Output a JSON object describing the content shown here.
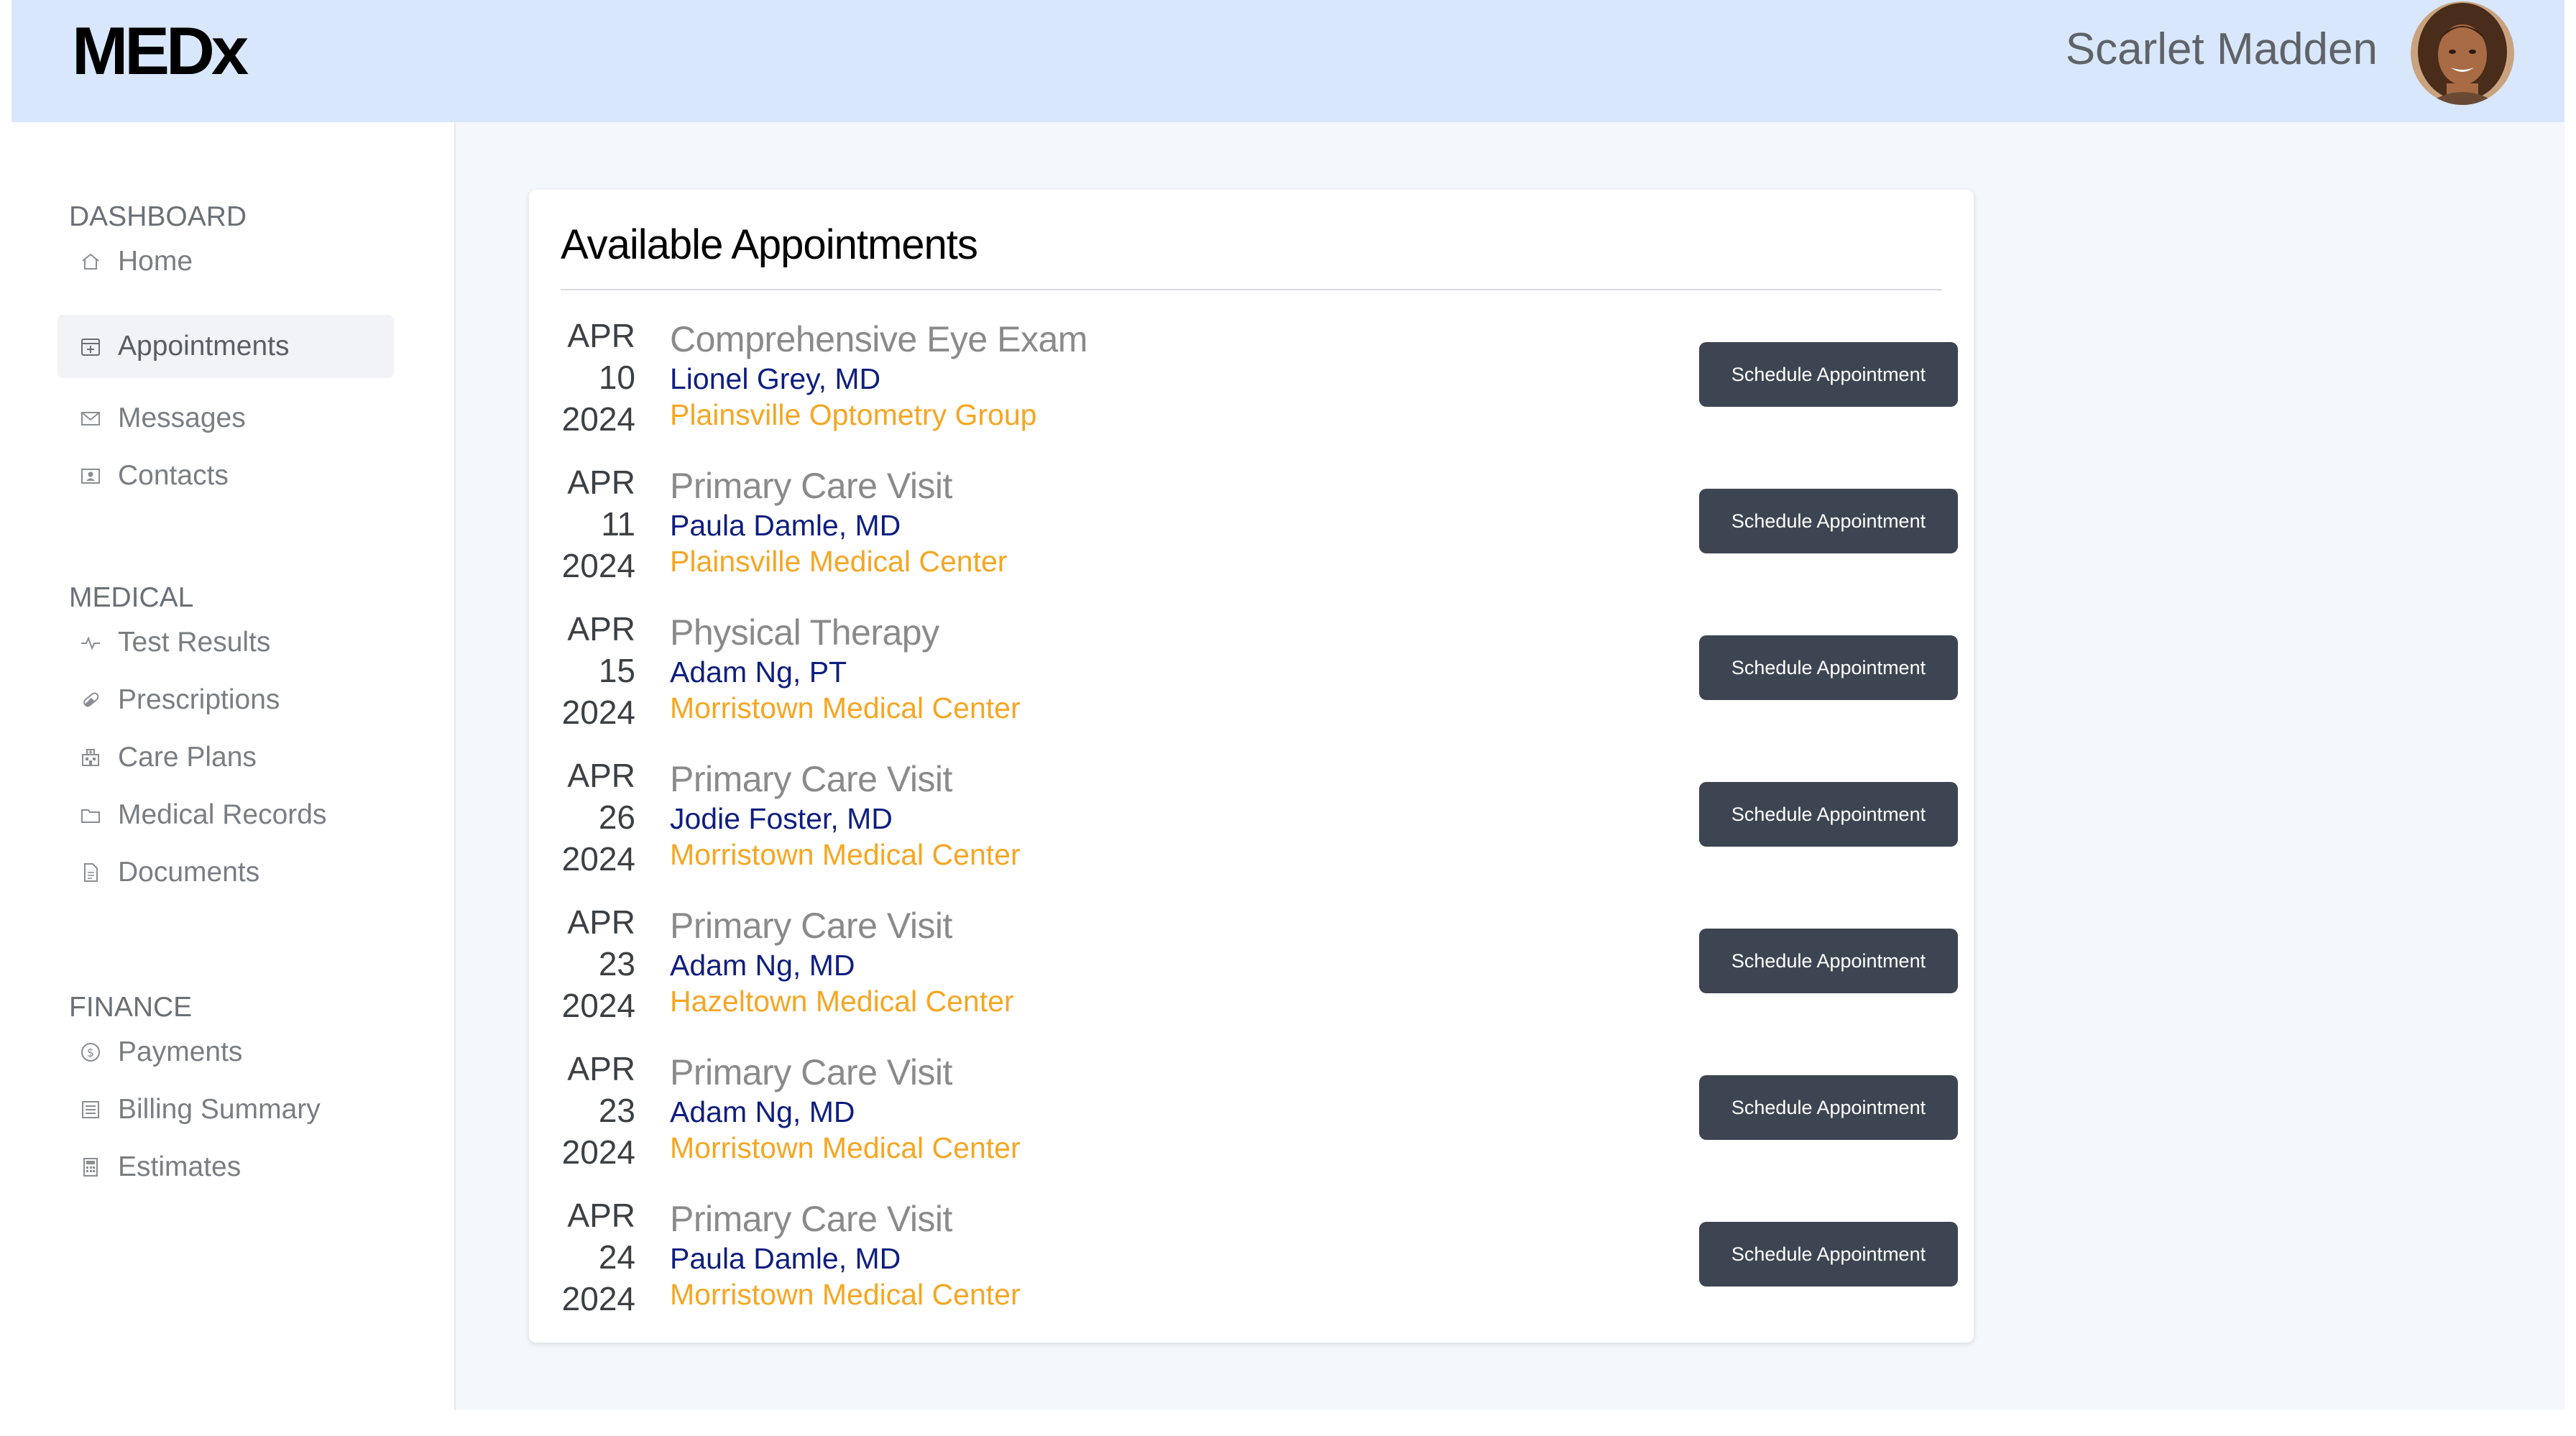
{
  "app": {
    "logo": "MEDx"
  },
  "user": {
    "name": "Scarlet Madden",
    "avatar_icon": "user-avatar-photo"
  },
  "sidebar": {
    "sections": [
      {
        "label": "DASHBOARD",
        "items": [
          {
            "label": "Home",
            "icon": "home-icon"
          },
          {
            "label": "Appointments",
            "icon": "calendar-icon",
            "active": true
          },
          {
            "label": "Messages",
            "icon": "envelope-icon"
          },
          {
            "label": "Contacts",
            "icon": "contact-card-icon"
          }
        ]
      },
      {
        "label": "MEDICAL",
        "items": [
          {
            "label": "Test Results",
            "icon": "pulse-icon"
          },
          {
            "label": "Prescriptions",
            "icon": "pill-icon"
          },
          {
            "label": "Care Plans",
            "icon": "hospital-icon"
          },
          {
            "label": "Medical Records",
            "icon": "folder-icon"
          },
          {
            "label": "Documents",
            "icon": "document-icon"
          }
        ]
      },
      {
        "label": "FINANCE",
        "items": [
          {
            "label": "Payments",
            "icon": "dollar-coin-icon"
          },
          {
            "label": "Billing Summary",
            "icon": "receipt-icon"
          },
          {
            "label": "Estimates",
            "icon": "calculator-icon"
          }
        ]
      }
    ]
  },
  "main": {
    "title": "Available Appointments",
    "button_label": "Schedule Appointment",
    "appointments": [
      {
        "month": "APR",
        "day": "10",
        "year": "2024",
        "type": "Comprehensive Eye Exam",
        "provider": "Lionel Grey, MD",
        "location": "Plainsville Optometry Group"
      },
      {
        "month": "APR",
        "day": "11",
        "year": "2024",
        "type": "Primary Care Visit",
        "provider": "Paula Damle, MD",
        "location": "Plainsville Medical Center"
      },
      {
        "month": "APR",
        "day": "15",
        "year": "2024",
        "type": "Physical Therapy",
        "provider": "Adam Ng, PT",
        "location": "Morristown Medical Center"
      },
      {
        "month": "APR",
        "day": "26",
        "year": "2024",
        "type": "Primary Care Visit",
        "provider": "Jodie Foster, MD",
        "location": "Morristown Medical Center"
      },
      {
        "month": "APR",
        "day": "23",
        "year": "2024",
        "type": "Primary Care Visit",
        "provider": "Adam Ng, MD",
        "location": "Hazeltown Medical Center"
      },
      {
        "month": "APR",
        "day": "23",
        "year": "2024",
        "type": "Primary Care Visit",
        "provider": "Adam Ng, MD",
        "location": "Morristown Medical Center"
      },
      {
        "month": "APR",
        "day": "24",
        "year": "2024",
        "type": "Primary Care Visit",
        "provider": "Paula Damle, MD",
        "location": "Morristown Medical Center"
      }
    ]
  },
  "colors": {
    "header_bg": "#d8e7fb",
    "button_bg": "#3d4552",
    "provider_text": "#0e1e7f",
    "location_text": "#f5a623",
    "appointment_title": "#8a8a8a"
  }
}
